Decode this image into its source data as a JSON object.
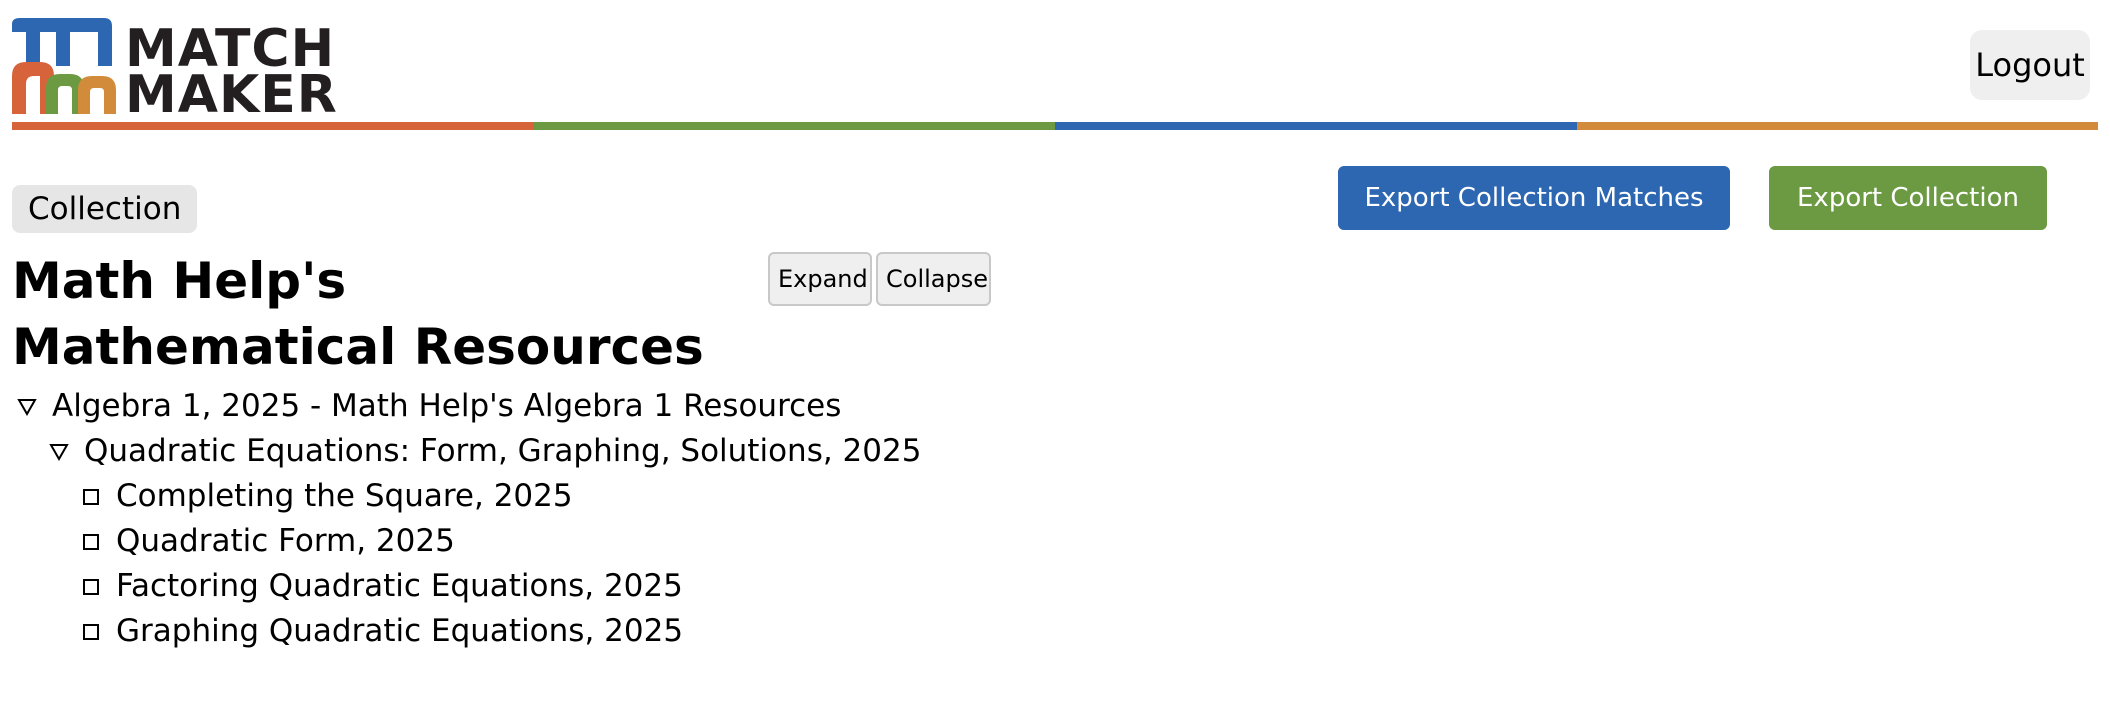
{
  "header": {
    "logo": {
      "line1": "MATCH",
      "line2": "MAKER"
    },
    "logout_label": "Logout",
    "color_bar": [
      "#d6633a",
      "#6b9a42",
      "#2e67b1",
      "#d18b3a"
    ]
  },
  "toolbar": {
    "tag_label": "Collection",
    "export_matches_label": "Export Collection Matches",
    "export_label": "Export Collection"
  },
  "page": {
    "title": "Math Help's Mathematical Resources",
    "expand_label": "Expand",
    "collapse_label": "Collapse"
  },
  "tree": {
    "items": [
      {
        "label": "Algebra 1, 2025 - Math Help's Algebra 1 Resources"
      },
      {
        "label": "Quadratic Equations: Form, Graphing, Solutions, 2025"
      },
      {
        "label": "Completing the Square, 2025"
      },
      {
        "label": "Quadratic Form, 2025"
      },
      {
        "label": "Factoring Quadratic Equations, 2025"
      },
      {
        "label": "Graphing Quadratic Equations, 2025"
      }
    ]
  },
  "colors": {
    "blue": "#2e67b1",
    "green": "#6b9a42",
    "orange": "#d6633a",
    "gold": "#d18b3a"
  }
}
